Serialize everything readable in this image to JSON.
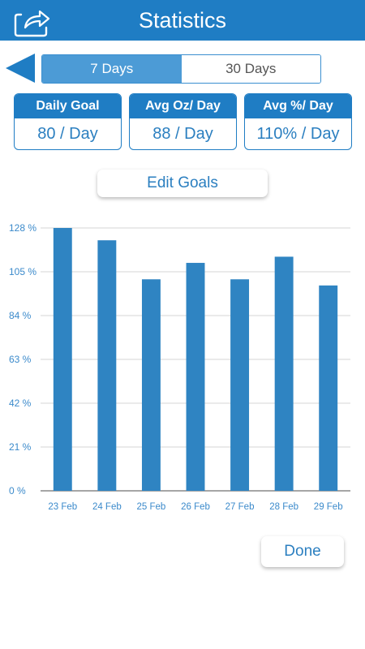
{
  "header": {
    "title": "Statistics",
    "share_icon": "share-icon"
  },
  "nav": {
    "back_icon": "back-arrow-icon"
  },
  "period_tabs": [
    {
      "label": "7 Days",
      "selected": true
    },
    {
      "label": "30 Days",
      "selected": false
    }
  ],
  "stats": [
    {
      "title": "Daily Goal",
      "value": "80 / Day"
    },
    {
      "title": "Avg Oz/ Day",
      "value": "88 / Day"
    },
    {
      "title": "Avg %/ Day",
      "value": "110% / Day"
    }
  ],
  "edit_goals_label": "Edit Goals",
  "done_label": "Done",
  "colors": {
    "primary": "#1f7dc4",
    "bar": "#2f84c2",
    "segment_active": "#4c9bd6",
    "tick_text": "#3b8acb"
  },
  "chart_data": {
    "type": "bar",
    "categories": [
      "23 Feb",
      "24 Feb",
      "25 Feb",
      "26 Feb",
      "27 Feb",
      "28 Feb",
      "29 Feb"
    ],
    "values": [
      128,
      122,
      103,
      111,
      103,
      114,
      100
    ],
    "y_ticks": [
      "0 %",
      "21 %",
      "42 %",
      "63 %",
      "84 %",
      "105 %",
      "128 %"
    ],
    "ylim": [
      0,
      128
    ],
    "grid": true,
    "title": "",
    "xlabel": "",
    "ylabel": ""
  }
}
